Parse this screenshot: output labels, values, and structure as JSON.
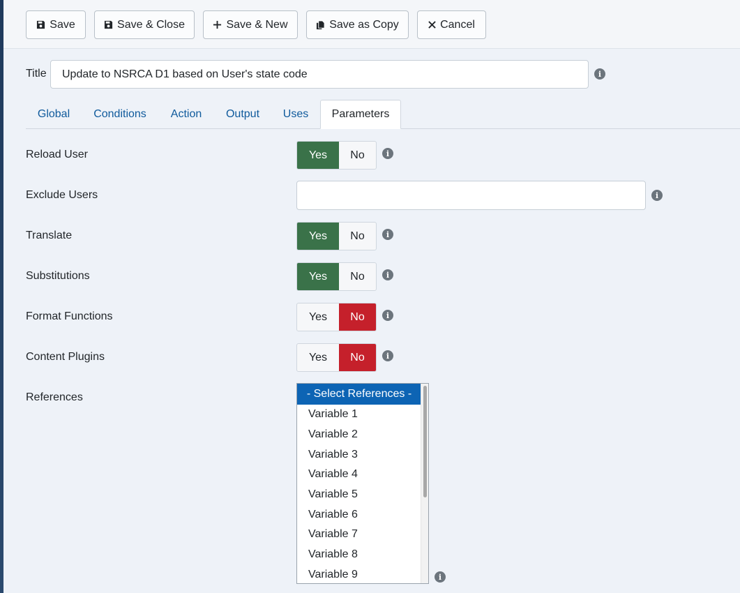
{
  "toolbar": {
    "save": "Save",
    "save_close": "Save & Close",
    "save_new": "Save & New",
    "save_copy": "Save as Copy",
    "cancel": "Cancel"
  },
  "title": {
    "label": "Title",
    "value": "Update to NSRCA D1 based on User's state code"
  },
  "tabs": [
    "Global",
    "Conditions",
    "Action",
    "Output",
    "Uses",
    "Parameters"
  ],
  "active_tab": "Parameters",
  "fields": {
    "reload_user": {
      "label": "Reload User",
      "value": "Yes"
    },
    "exclude_users": {
      "label": "Exclude Users",
      "value": ""
    },
    "translate": {
      "label": "Translate",
      "value": "Yes"
    },
    "substitutions": {
      "label": "Substitutions",
      "value": "Yes"
    },
    "format_functions": {
      "label": "Format Functions",
      "value": "No"
    },
    "content_plugins": {
      "label": "Content Plugins",
      "value": "No"
    },
    "references": {
      "label": "References",
      "placeholder": "- Select References -",
      "options": [
        "Variable 1",
        "Variable 2",
        "Variable 3",
        "Variable 4",
        "Variable 5",
        "Variable 6",
        "Variable 7",
        "Variable 8",
        "Variable 9"
      ]
    }
  },
  "toggle_labels": {
    "yes": "Yes",
    "no": "No"
  },
  "colors": {
    "yes_active": "#3a7249",
    "no_active": "#c5202b",
    "link": "#0f5a9c",
    "list_selected": "#0d64b4"
  }
}
